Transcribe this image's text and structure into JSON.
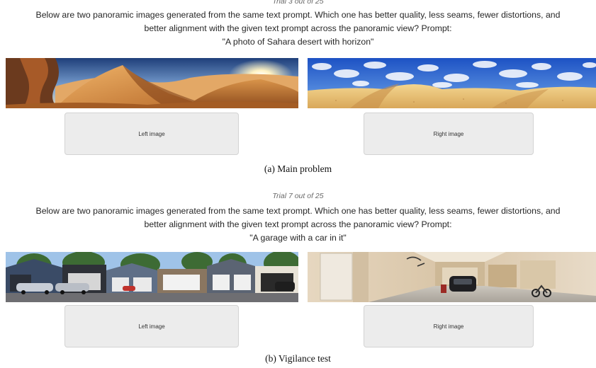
{
  "panels": [
    {
      "trial_label": "Trial 3 out of 25",
      "question_line1": "Below are two panoramic images generated from the same text prompt. Which one has better quality, less seams, fewer distortions, and",
      "question_line2": "better alignment with the given text prompt across the panoramic view? Prompt:",
      "prompt": "\"A photo of Sahara desert with horizon\"",
      "left_button": "Left image",
      "right_button": "Right image",
      "caption": "(a) Main problem"
    },
    {
      "trial_label": "Trial 7 out of 25",
      "question_line1": "Below are two panoramic images generated from the same text prompt. Which one has better quality, less seams, fewer distortions, and",
      "question_line2": "better alignment with the given text prompt across the panoramic view? Prompt:",
      "prompt": "\"A garage with a car in it\"",
      "left_button": "Left image",
      "right_button": "Right image",
      "caption": "(b) Vigilance test"
    }
  ]
}
